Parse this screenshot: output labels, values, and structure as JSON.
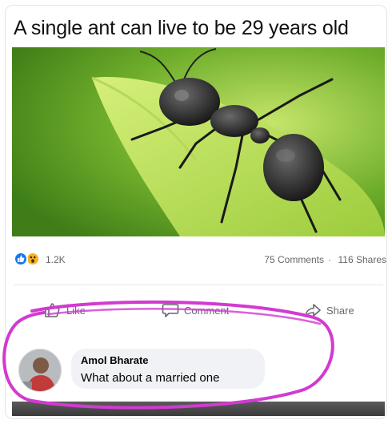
{
  "post": {
    "headline": "A single ant can live to be 29 years old",
    "reactions_count": "1.2K",
    "comments_count": "75 Comments",
    "separator": "·",
    "shares_count": "116 Shares"
  },
  "actions": {
    "like": "Like",
    "comment": "Comment",
    "share": "Share"
  },
  "comment": {
    "author": "Amol Bharate",
    "text": "What about a married one"
  },
  "icons": {
    "reaction_like": "thumbs-up-icon",
    "reaction_wow": "wow-face-icon",
    "like_action": "thumbs-up-outline-icon",
    "comment_action": "speech-bubble-icon",
    "share_action": "share-arrow-icon"
  },
  "colors": {
    "facebook_blue": "#1877f2",
    "wow_yellow": "#f7b125",
    "highlight_magenta": "#d23ad1",
    "leaf_green": "#8fc43a"
  }
}
